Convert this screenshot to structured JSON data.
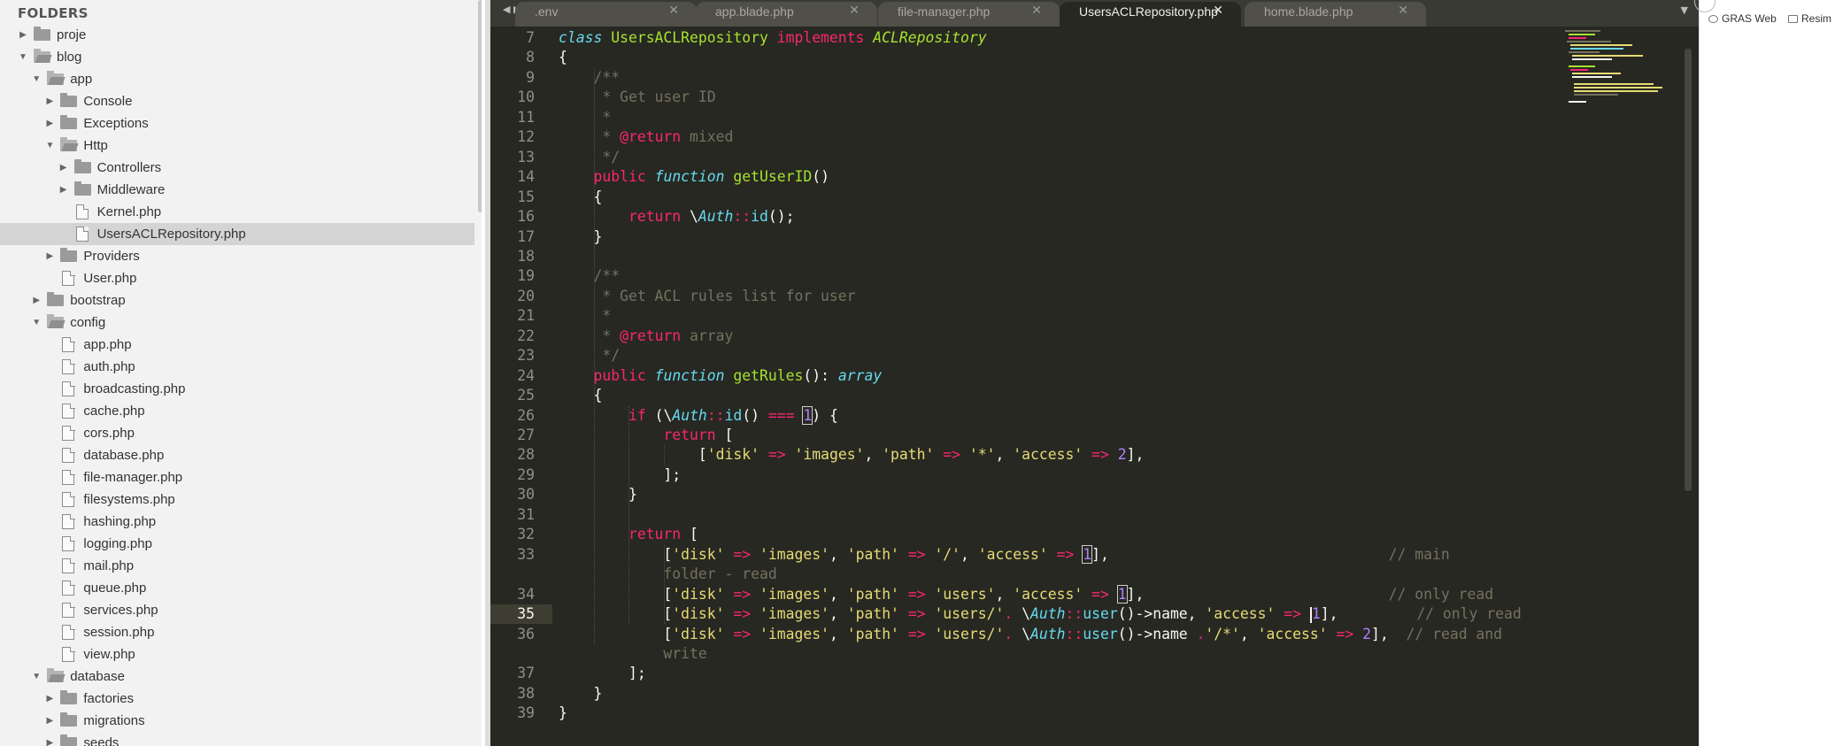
{
  "sidebar": {
    "title": "FOLDERS",
    "items": [
      {
        "label": "proje",
        "type": "folder",
        "open": false,
        "depth": 0
      },
      {
        "label": "blog",
        "type": "folder",
        "open": true,
        "depth": 0
      },
      {
        "label": "app",
        "type": "folder",
        "open": true,
        "depth": 1
      },
      {
        "label": "Console",
        "type": "folder",
        "open": false,
        "depth": 2
      },
      {
        "label": "Exceptions",
        "type": "folder",
        "open": false,
        "depth": 2
      },
      {
        "label": "Http",
        "type": "folder",
        "open": true,
        "depth": 2
      },
      {
        "label": "Controllers",
        "type": "folder",
        "open": false,
        "depth": 3
      },
      {
        "label": "Middleware",
        "type": "folder",
        "open": false,
        "depth": 3
      },
      {
        "label": "Kernel.php",
        "type": "file",
        "depth": 3
      },
      {
        "label": "UsersACLRepository.php",
        "type": "file",
        "depth": 3,
        "selected": true
      },
      {
        "label": "Providers",
        "type": "folder",
        "open": false,
        "depth": 2
      },
      {
        "label": "User.php",
        "type": "file",
        "depth": 2
      },
      {
        "label": "bootstrap",
        "type": "folder",
        "open": false,
        "depth": 1
      },
      {
        "label": "config",
        "type": "folder",
        "open": true,
        "depth": 1
      },
      {
        "label": "app.php",
        "type": "file",
        "depth": 2
      },
      {
        "label": "auth.php",
        "type": "file",
        "depth": 2
      },
      {
        "label": "broadcasting.php",
        "type": "file",
        "depth": 2
      },
      {
        "label": "cache.php",
        "type": "file",
        "depth": 2
      },
      {
        "label": "cors.php",
        "type": "file",
        "depth": 2
      },
      {
        "label": "database.php",
        "type": "file",
        "depth": 2
      },
      {
        "label": "file-manager.php",
        "type": "file",
        "depth": 2
      },
      {
        "label": "filesystems.php",
        "type": "file",
        "depth": 2
      },
      {
        "label": "hashing.php",
        "type": "file",
        "depth": 2
      },
      {
        "label": "logging.php",
        "type": "file",
        "depth": 2
      },
      {
        "label": "mail.php",
        "type": "file",
        "depth": 2
      },
      {
        "label": "queue.php",
        "type": "file",
        "depth": 2
      },
      {
        "label": "services.php",
        "type": "file",
        "depth": 2
      },
      {
        "label": "session.php",
        "type": "file",
        "depth": 2
      },
      {
        "label": "view.php",
        "type": "file",
        "depth": 2
      },
      {
        "label": "database",
        "type": "folder",
        "open": true,
        "depth": 1
      },
      {
        "label": "factories",
        "type": "folder",
        "open": false,
        "depth": 2
      },
      {
        "label": "migrations",
        "type": "folder",
        "open": false,
        "depth": 2
      },
      {
        "label": "seeds",
        "type": "folder",
        "open": false,
        "depth": 2
      }
    ]
  },
  "tabs": [
    {
      "label": ".env",
      "active": false
    },
    {
      "label": "app.blade.php",
      "active": false
    },
    {
      "label": "file-manager.php",
      "active": false
    },
    {
      "label": "UsersACLRepository.php",
      "active": true
    },
    {
      "label": "home.blade.php",
      "active": false
    }
  ],
  "tab_close_glyph": "✕",
  "editor": {
    "current_line": 35,
    "lines": [
      {
        "n": "7",
        "html": "<span class='t'>class</span> <span class='f'>UsersACLRepository</span> <span class='k'>implements</span> <span class='ti'>ACLRepository</span>"
      },
      {
        "n": "8",
        "html": "<span class='p'>{</span>"
      },
      {
        "n": "9",
        "html": "    <span class='c'>/**</span>"
      },
      {
        "n": "10",
        "html": "    <span class='c'> * Get user ID</span>"
      },
      {
        "n": "11",
        "html": "    <span class='c'> *</span>"
      },
      {
        "n": "12",
        "html": "    <span class='c'> * </span><span class='k'>@return</span><span class='c'> mixed</span>"
      },
      {
        "n": "13",
        "html": "    <span class='c'> */</span>"
      },
      {
        "n": "14",
        "html": "    <span class='k'>public</span> <span class='t'>function</span> <span class='f'>getUserID</span><span class='p'>()</span>"
      },
      {
        "n": "15",
        "html": "    <span class='p'>{</span>"
      },
      {
        "n": "16",
        "html": "        <span class='k'>return</span> <span class='p'>\\</span><span class='t'>Auth</span><span class='k'>::</span><span class='t' style='font-style:normal'>id</span><span class='p'>();</span>"
      },
      {
        "n": "17",
        "html": "    <span class='p'>}</span>"
      },
      {
        "n": "18",
        "html": ""
      },
      {
        "n": "19",
        "html": "    <span class='c'>/**</span>"
      },
      {
        "n": "20",
        "html": "    <span class='c'> * Get ACL rules list for user</span>"
      },
      {
        "n": "21",
        "html": "    <span class='c'> *</span>"
      },
      {
        "n": "22",
        "html": "    <span class='c'> * </span><span class='k'>@return</span><span class='c'> array</span>"
      },
      {
        "n": "23",
        "html": "    <span class='c'> */</span>"
      },
      {
        "n": "24",
        "html": "    <span class='k'>public</span> <span class='t'>function</span> <span class='f'>getRules</span><span class='p'>(): </span><span class='t'>array</span>"
      },
      {
        "n": "25",
        "html": "    <span class='p'>{</span>"
      },
      {
        "n": "26",
        "html": "        <span class='k'>if</span> <span class='p'>(\\</span><span class='t'>Auth</span><span class='k'>::</span><span class='t' style='font-style:normal'>id</span><span class='p'>() </span><span class='k'>===</span> <span class='n bx'>1</span><span class='p'>) {</span>"
      },
      {
        "n": "27",
        "html": "            <span class='k'>return</span> <span class='p'>[</span>"
      },
      {
        "n": "28",
        "html": "                <span class='p'>[</span><span class='s'>'disk'</span> <span class='k'>=&gt;</span> <span class='s'>'images'</span><span class='p'>, </span><span class='s'>'path'</span> <span class='k'>=&gt;</span> <span class='s'>'*'</span><span class='p'>, </span><span class='s'>'access'</span> <span class='k'>=&gt;</span> <span class='n'>2</span><span class='p'>],</span>"
      },
      {
        "n": "29",
        "html": "            <span class='p'>];</span>"
      },
      {
        "n": "30",
        "html": "        <span class='p'>}</span>"
      },
      {
        "n": "31",
        "html": ""
      },
      {
        "n": "32",
        "html": "        <span class='k'>return</span> <span class='p'>[</span>"
      },
      {
        "n": "33",
        "html": "            <span class='p'>[</span><span class='s'>'disk'</span> <span class='k'>=&gt;</span> <span class='s'>'images'</span><span class='p'>, </span><span class='s'>'path'</span> <span class='k'>=&gt;</span> <span class='s'>'/'</span><span class='p'>, </span><span class='s'>'access'</span> <span class='k'>=&gt;</span> <span class='n bx'>1</span><span class='p'>],</span>                                <span class='c'>// main</span>"
      },
      {
        "n": "",
        "html": "            <span class='c'>folder - read</span>"
      },
      {
        "n": "34",
        "html": "            <span class='p'>[</span><span class='s'>'disk'</span> <span class='k'>=&gt;</span> <span class='s'>'images'</span><span class='p'>, </span><span class='s'>'path'</span> <span class='k'>=&gt;</span> <span class='s'>'users'</span><span class='p'>, </span><span class='s'>'access'</span> <span class='k'>=&gt;</span> <span class='n bx'>1</span><span class='p'>],</span>                            <span class='c'>// only read</span>"
      },
      {
        "n": "35",
        "html": "            <span class='p'>[</span><span class='s'>'disk'</span> <span class='k'>=&gt;</span> <span class='s'>'images'</span><span class='p'>, </span><span class='s'>'path'</span> <span class='k'>=&gt;</span> <span class='s'>'users/'</span><span class='k'>.</span> <span class='p'>\\</span><span class='t'>Auth</span><span class='k'>::</span><span class='t' style='font-style:normal'>user</span><span class='p'>()-&gt;name, </span><span class='s'>'access'</span> <span class='k'>=&gt;</span> <span class='caret'></span><span class='n'>1</span><span class='p'>],</span>         <span class='c'>// only read</span>"
      },
      {
        "n": "36",
        "html": "            <span class='p'>[</span><span class='s'>'disk'</span> <span class='k'>=&gt;</span> <span class='s'>'images'</span><span class='p'>, </span><span class='s'>'path'</span> <span class='k'>=&gt;</span> <span class='s'>'users/'</span><span class='k'>.</span> <span class='p'>\\</span><span class='t'>Auth</span><span class='k'>::</span><span class='t' style='font-style:normal'>user</span><span class='p'>()-&gt;name </span><span class='k'>.</span><span class='s'>'/*'</span><span class='p'>, </span><span class='s'>'access'</span> <span class='k'>=&gt;</span> <span class='n'>2</span><span class='p'>],</span>  <span class='c'>// read and</span>"
      },
      {
        "n": "",
        "html": "            <span class='c'>write</span>"
      },
      {
        "n": "37",
        "html": "        <span class='p'>];</span>"
      },
      {
        "n": "38",
        "html": "    <span class='p'>}</span>"
      },
      {
        "n": "39",
        "html": "<span class='p'>}</span>"
      }
    ]
  },
  "bookmarks": [
    {
      "label": "GRAS Web",
      "icon": "bookmark-icon"
    },
    {
      "label": "Resim",
      "icon": "folder-icon"
    }
  ]
}
